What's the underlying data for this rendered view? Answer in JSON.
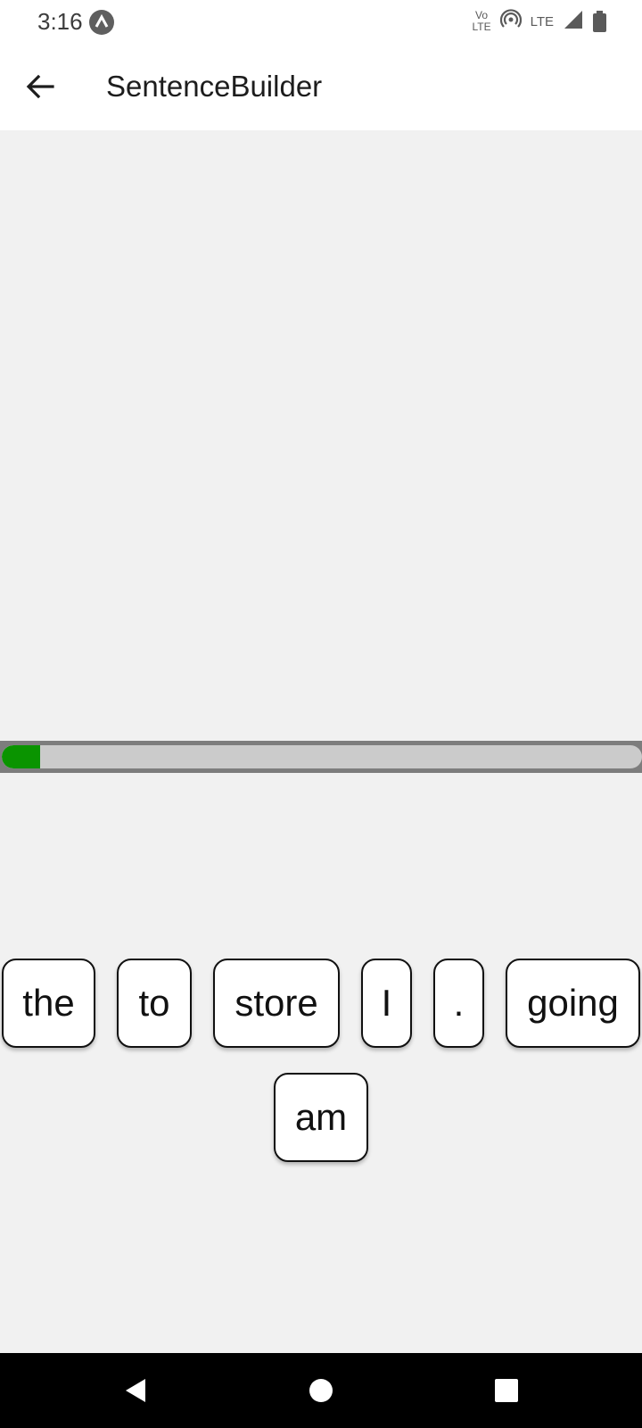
{
  "status_bar": {
    "time": "3:16",
    "volte_top": "Vo",
    "volte_bottom": "LTE",
    "network": "LTE"
  },
  "app_bar": {
    "title": "SentenceBuilder",
    "back_icon": "arrow-left-icon"
  },
  "progress": {
    "value_percent": 6,
    "fill_color": "#0a9400",
    "track_color": "#cbcbcb"
  },
  "word_bank": {
    "words": [
      "the",
      "to",
      "store",
      "I",
      ".",
      "going",
      "am"
    ]
  },
  "nav_bar": {
    "back_icon": "triangle-back-icon",
    "home_icon": "circle-home-icon",
    "recents_icon": "square-recents-icon"
  }
}
